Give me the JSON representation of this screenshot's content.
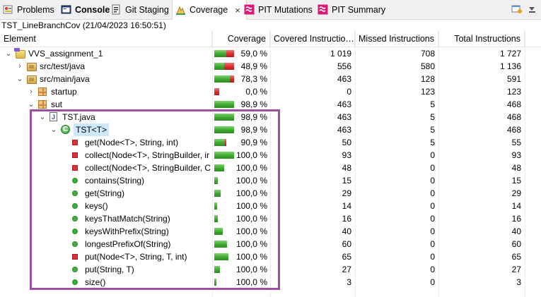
{
  "tabs": [
    {
      "label": "Problems",
      "icon": "problems-icon",
      "active": false
    },
    {
      "label": "Console",
      "icon": "console-icon",
      "active": false,
      "bold": true
    },
    {
      "label": "Git Staging",
      "icon": "git-staging-icon",
      "active": false
    },
    {
      "label": "Coverage",
      "icon": "coverage-icon",
      "active": true,
      "close": "×"
    },
    {
      "label": "PIT Mutations",
      "icon": "pit-icon",
      "active": false
    },
    {
      "label": "PIT Summary",
      "icon": "pit-icon",
      "active": false
    }
  ],
  "session": "TST_LineBranchCov (21/04/2023 16:50:51)",
  "columns": {
    "element": "Element",
    "coverage": "Coverage",
    "covered": "Covered Instructio…",
    "missed": "Missed Instructions",
    "total": "Total Instructions"
  },
  "colors": {
    "covered_bar": "#3aa32c",
    "missed_bar": "#d62828",
    "highlight_border": "#9b4fa0",
    "selection": "#cce8ff"
  },
  "rows": [
    {
      "indent": 0,
      "twisty": "⌄",
      "icon": "project-icon",
      "label": "VVS_assignment_1",
      "coverage": "59,0 %",
      "ratio": 0.59,
      "covered": "1 019",
      "missed": "708",
      "total": "1 727",
      "bar_total": 1727
    },
    {
      "indent": 1,
      "twisty": "›",
      "icon": "source-folder-icon",
      "label": "src/test/java",
      "coverage": "48,9 %",
      "ratio": 0.489,
      "covered": "556",
      "missed": "580",
      "total": "1 136",
      "bar_total": 1136
    },
    {
      "indent": 1,
      "twisty": "⌄",
      "icon": "source-folder-icon",
      "label": "src/main/java",
      "coverage": "78,3 %",
      "ratio": 0.783,
      "covered": "463",
      "missed": "128",
      "total": "591",
      "bar_total": 591
    },
    {
      "indent": 2,
      "twisty": "›",
      "icon": "package-icon",
      "label": "startup",
      "coverage": "0,0 %",
      "ratio": 0.0,
      "covered": "0",
      "missed": "123",
      "total": "123",
      "bar_total": 123
    },
    {
      "indent": 2,
      "twisty": "⌄",
      "icon": "package-icon",
      "label": "sut",
      "coverage": "98,9 %",
      "ratio": 0.989,
      "covered": "463",
      "missed": "5",
      "total": "468",
      "bar_total": 468
    },
    {
      "indent": 3,
      "twisty": "⌄",
      "icon": "java-file-icon",
      "label": "TST.java",
      "coverage": "98,9 %",
      "ratio": 0.989,
      "covered": "463",
      "missed": "5",
      "total": "468",
      "bar_total": 468
    },
    {
      "indent": 4,
      "twisty": "⌄",
      "icon": "class-icon",
      "label": "TST<T>",
      "coverage": "98,9 %",
      "ratio": 0.989,
      "covered": "463",
      "missed": "5",
      "total": "468",
      "bar_total": 468,
      "selected": true
    },
    {
      "indent": 5,
      "twisty": "",
      "icon": "private-method-icon",
      "label": "get(Node<T>, String, int)",
      "coverage": "90,9 %",
      "ratio": 0.909,
      "covered": "50",
      "missed": "5",
      "total": "55",
      "bar_total": 55
    },
    {
      "indent": 5,
      "twisty": "",
      "icon": "private-method-icon",
      "label": "collect(Node<T>, StringBuilder, ir",
      "coverage": "100,0 %",
      "ratio": 1.0,
      "covered": "93",
      "missed": "0",
      "total": "93",
      "bar_total": 93
    },
    {
      "indent": 5,
      "twisty": "",
      "icon": "private-method-icon",
      "label": "collect(Node<T>, StringBuilder, C",
      "coverage": "100,0 %",
      "ratio": 1.0,
      "covered": "48",
      "missed": "0",
      "total": "48",
      "bar_total": 48
    },
    {
      "indent": 5,
      "twisty": "",
      "icon": "public-method-icon",
      "label": "contains(String)",
      "coverage": "100,0 %",
      "ratio": 1.0,
      "covered": "15",
      "missed": "0",
      "total": "15",
      "bar_total": 15
    },
    {
      "indent": 5,
      "twisty": "",
      "icon": "public-method-icon",
      "label": "get(String)",
      "coverage": "100,0 %",
      "ratio": 1.0,
      "covered": "29",
      "missed": "0",
      "total": "29",
      "bar_total": 29
    },
    {
      "indent": 5,
      "twisty": "",
      "icon": "public-method-icon",
      "label": "keys()",
      "coverage": "100,0 %",
      "ratio": 1.0,
      "covered": "14",
      "missed": "0",
      "total": "14",
      "bar_total": 14
    },
    {
      "indent": 5,
      "twisty": "",
      "icon": "public-method-icon",
      "label": "keysThatMatch(String)",
      "coverage": "100,0 %",
      "ratio": 1.0,
      "covered": "16",
      "missed": "0",
      "total": "16",
      "bar_total": 16
    },
    {
      "indent": 5,
      "twisty": "",
      "icon": "public-method-icon",
      "label": "keysWithPrefix(String)",
      "coverage": "100,0 %",
      "ratio": 1.0,
      "covered": "40",
      "missed": "0",
      "total": "40",
      "bar_total": 40
    },
    {
      "indent": 5,
      "twisty": "",
      "icon": "public-method-icon",
      "label": "longestPrefixOf(String)",
      "coverage": "100,0 %",
      "ratio": 1.0,
      "covered": "60",
      "missed": "0",
      "total": "60",
      "bar_total": 60
    },
    {
      "indent": 5,
      "twisty": "",
      "icon": "private-method-icon",
      "label": "put(Node<T>, String, T, int)",
      "coverage": "100,0 %",
      "ratio": 1.0,
      "covered": "65",
      "missed": "0",
      "total": "65",
      "bar_total": 65
    },
    {
      "indent": 5,
      "twisty": "",
      "icon": "public-method-icon",
      "label": "put(String, T)",
      "coverage": "100,0 %",
      "ratio": 1.0,
      "covered": "27",
      "missed": "0",
      "total": "27",
      "bar_total": 27
    },
    {
      "indent": 5,
      "twisty": "",
      "icon": "public-method-icon",
      "label": "size()",
      "coverage": "100,0 %",
      "ratio": 1.0,
      "covered": "3",
      "missed": "0",
      "total": "3",
      "bar_total": 3
    }
  ]
}
